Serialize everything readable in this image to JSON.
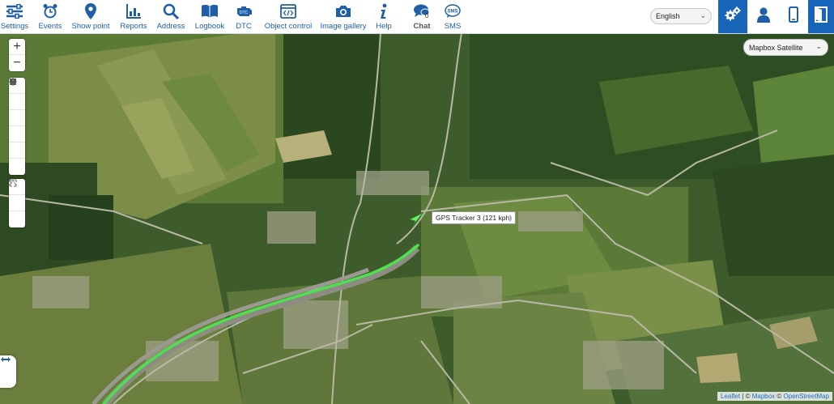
{
  "toolbar": {
    "items": [
      {
        "label": "Settings",
        "icon": "settings-sliders-icon"
      },
      {
        "label": "Events",
        "icon": "alarm-clock-icon"
      },
      {
        "label": "Show point",
        "icon": "map-pin-icon"
      },
      {
        "label": "Reports",
        "icon": "chart-icon"
      },
      {
        "label": "Address",
        "icon": "search-icon"
      },
      {
        "label": "Logbook",
        "icon": "book-icon"
      },
      {
        "label": "DTC",
        "icon": "engine-icon"
      },
      {
        "label": "Object control",
        "icon": "code-window-icon"
      },
      {
        "label": "Image gallery",
        "icon": "camera-icon"
      },
      {
        "label": "Help",
        "icon": "info-icon"
      },
      {
        "label": "Chat",
        "icon": "chat-bubble-icon",
        "badge": "0"
      },
      {
        "label": "SMS",
        "icon": "sms-bubble-icon"
      }
    ],
    "language": "English",
    "right_icons": [
      "gear-icon",
      "user-icon",
      "mobile-phone-icon",
      "logout-icon"
    ]
  },
  "map": {
    "layer_select": "Mapbox Satellite",
    "tooltip": "GPS Tracker 3 (121 kph)",
    "zoom_in": "+",
    "zoom_out": "−",
    "tools": [
      "navigate-arrow-icon",
      "text-tool-icon",
      "shield-icon",
      "road-icon",
      "circle-target-icon",
      "sun-burst-icon"
    ],
    "tools2": [
      "fullscreen-icon",
      "ruler-icon",
      "angle-icon"
    ],
    "attribution": {
      "leaflet": "Leaflet",
      "sep1": " | © ",
      "mapbox": "Mapbox",
      "sep2": " © ",
      "osm": "OpenStreetMap"
    }
  },
  "colors": {
    "accent": "#1665b8",
    "track": "#4ee04e"
  }
}
